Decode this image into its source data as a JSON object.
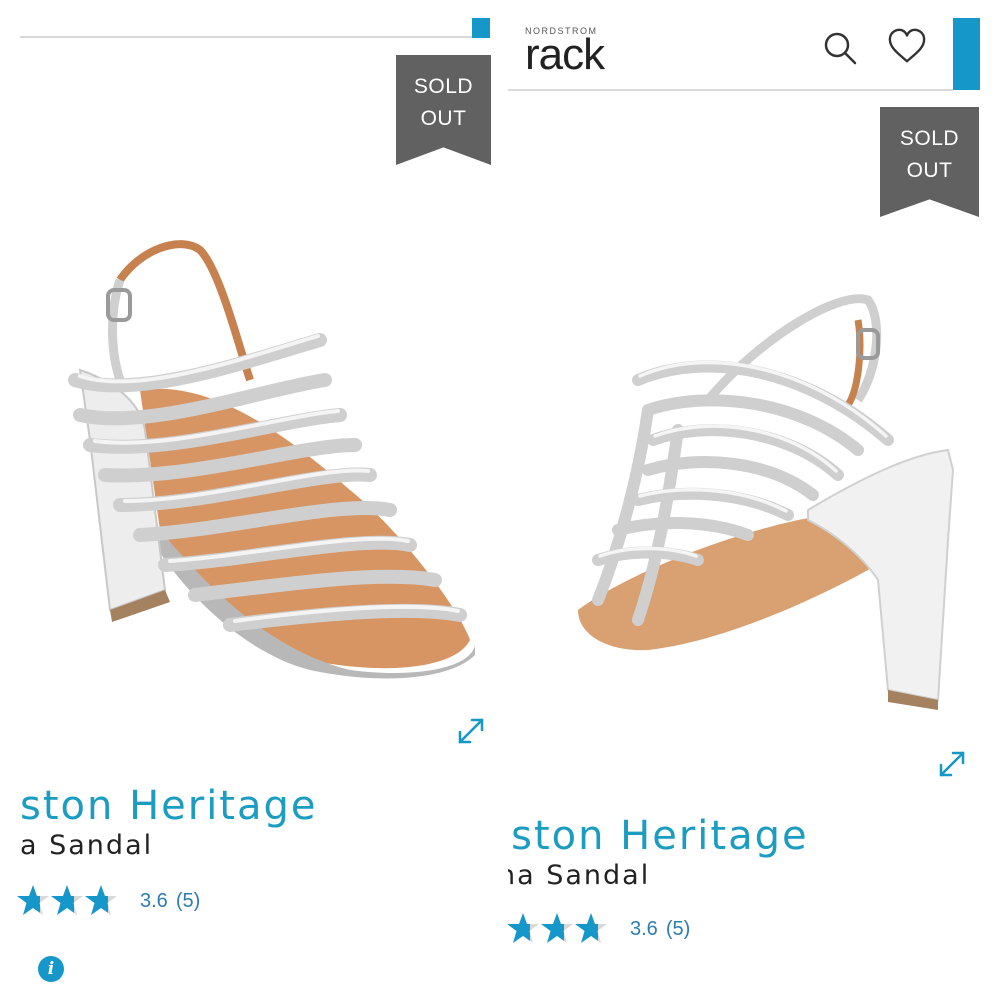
{
  "header": {
    "logo_small": "NORDSTROM",
    "logo_big": "rack",
    "search_icon": "search-icon",
    "wishlist_icon": "heart-icon"
  },
  "badge": {
    "line1": "SOLD",
    "line2": "OUT"
  },
  "product_left": {
    "title": "ston Heritage",
    "subtitle": "a Sandal",
    "rating_value": "3.6",
    "rating_count": "(5)",
    "rating_fraction": 0.72
  },
  "product_right": {
    "title": "lston Heritage",
    "subtitle": "na Sandal",
    "rating_value": "3.6",
    "rating_count": "(5)",
    "rating_fraction": 0.72
  },
  "icons": {
    "expand": "expand-icon",
    "info": "info-icon",
    "info_glyph": "i",
    "star": "star-icon"
  },
  "colors": {
    "accent": "#1697c9",
    "title": "#1b9cc1",
    "badge": "#616161",
    "star_empty": "#d8d8d8",
    "rating_text": "#2c7db0"
  }
}
